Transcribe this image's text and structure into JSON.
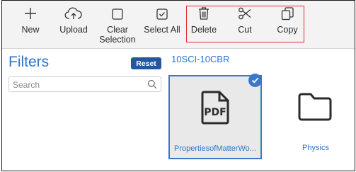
{
  "toolbar": {
    "new_label": "New",
    "upload_label": "Upload",
    "clear_label_line1": "Clear",
    "clear_label_line2": "Selection",
    "select_all_label": "Select All",
    "delete_label": "Delete",
    "cut_label": "Cut",
    "copy_label": "Copy"
  },
  "filters": {
    "title": "Filters",
    "reset_label": "Reset",
    "search_placeholder": "Search"
  },
  "main": {
    "folder_path": "10SCI-10CBR",
    "items": [
      {
        "name": "PropertiesofMatterWo...",
        "type": "pdf",
        "icon": "pdf-file-icon",
        "selected": true
      },
      {
        "name": "Physics",
        "type": "folder",
        "icon": "folder-icon",
        "selected": false
      }
    ]
  },
  "colors": {
    "accent": "#2c74c8",
    "reset_button": "#25579c",
    "selection_border": "#3c78c6",
    "highlight_box": "#e0302f",
    "toolbar_bg": "#f3f3f3"
  }
}
